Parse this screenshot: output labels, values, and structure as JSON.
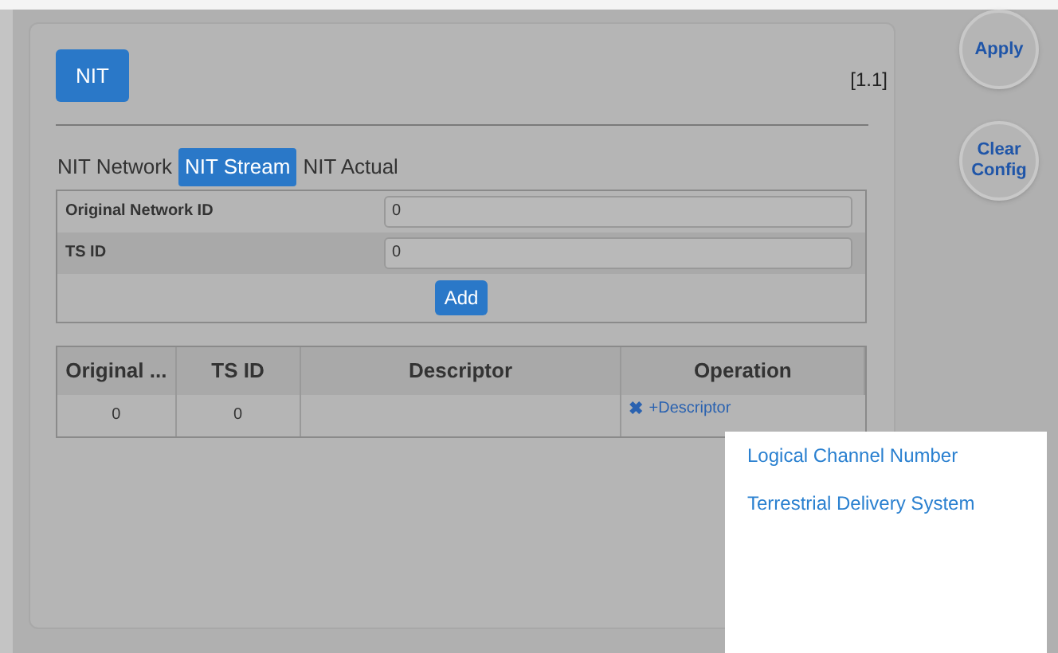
{
  "header": {
    "title_button": "NIT",
    "version": "[1.1]"
  },
  "tabs": [
    {
      "label": "NIT Network",
      "selected": false
    },
    {
      "label": "NIT Stream",
      "selected": true
    },
    {
      "label": "NIT Actual",
      "selected": false
    }
  ],
  "form": {
    "fields": [
      {
        "label": "Original Network ID",
        "value": "0"
      },
      {
        "label": "TS ID",
        "value": "0"
      }
    ],
    "add_button": "Add"
  },
  "table": {
    "columns": [
      "Original ...",
      "TS ID",
      "Descriptor",
      "Operation"
    ],
    "rows": [
      {
        "cells": [
          "0",
          "0",
          ""
        ],
        "delete_icon": "✖",
        "add_descriptor": "+Descriptor"
      }
    ]
  },
  "side_buttons": [
    "Apply",
    "Clear Config"
  ],
  "menu": {
    "items": [
      "Logical Channel Number",
      "Terrestrial Delivery System"
    ]
  }
}
